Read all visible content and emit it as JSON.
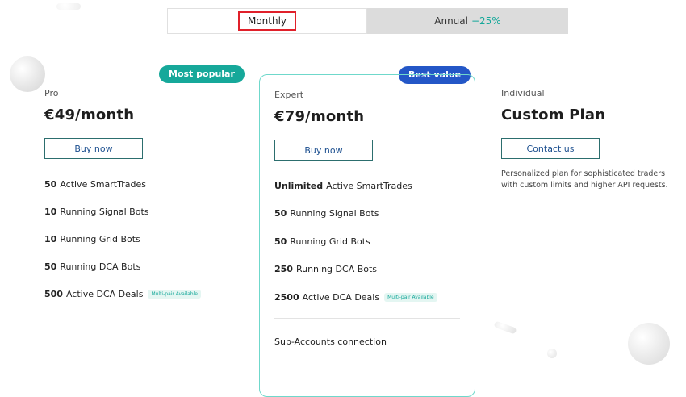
{
  "toggle": {
    "monthly": "Monthly",
    "annual": "Annual",
    "annual_discount": "−25%"
  },
  "plans": {
    "pro": {
      "badge": "Most popular",
      "name": "Pro",
      "price": "€49/month",
      "button": "Buy now",
      "features": [
        {
          "bold": "50",
          "text": "Active SmartTrades"
        },
        {
          "bold": "10",
          "text": "Running Signal Bots"
        },
        {
          "bold": "10",
          "text": "Running Grid Bots"
        },
        {
          "bold": "50",
          "text": "Running DCA Bots"
        },
        {
          "bold": "500",
          "text": "Active DCA Deals",
          "tag": "Multi-pair Available"
        }
      ]
    },
    "expert": {
      "badge": "Best value",
      "name": "Expert",
      "price": "€79/month",
      "button": "Buy now",
      "features": [
        {
          "bold": "Unlimited",
          "text": "Active SmartTrades"
        },
        {
          "bold": "50",
          "text": "Running Signal Bots"
        },
        {
          "bold": "50",
          "text": "Running Grid Bots"
        },
        {
          "bold": "250",
          "text": "Running DCA Bots"
        },
        {
          "bold": "2500",
          "text": "Active DCA Deals",
          "tag": "Multi-pair Available"
        }
      ],
      "extra": "Sub-Accounts connection"
    },
    "individual": {
      "name": "Individual",
      "price": "Custom Plan",
      "button": "Contact us",
      "description": "Personalized plan for sophisticated traders with custom limits and higher API requests."
    }
  },
  "colors": {
    "accent": "#16a89a",
    "best_value": "#2457c7",
    "highlight": "#e0202a"
  }
}
